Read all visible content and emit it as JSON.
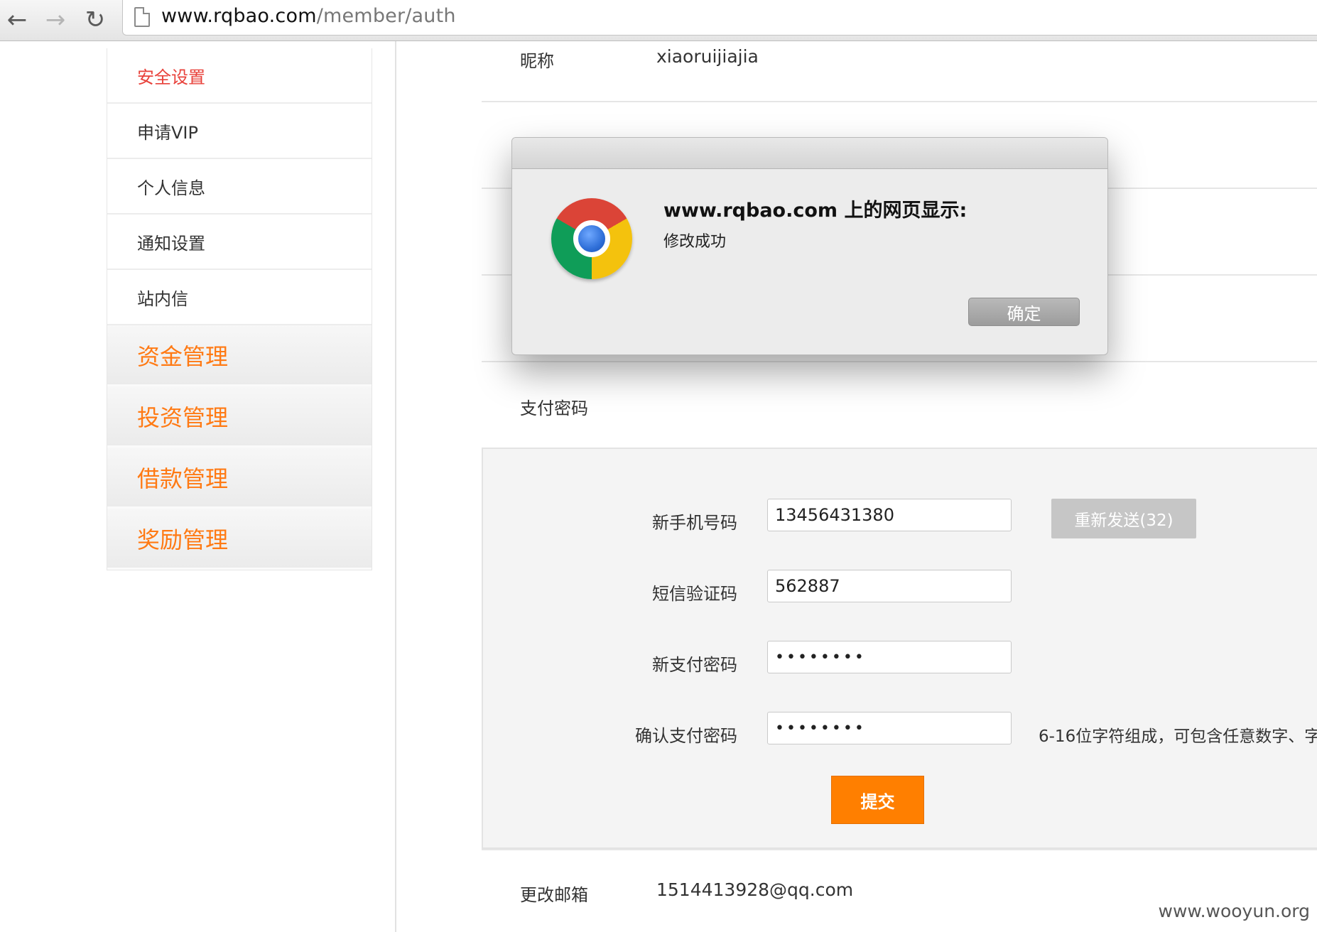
{
  "browser": {
    "url_host": "www.rqbao.com",
    "url_path": "/member/auth"
  },
  "sidebar": {
    "items": [
      {
        "label": "安全设置"
      },
      {
        "label": "申请VIP"
      },
      {
        "label": "个人信息"
      },
      {
        "label": "通知设置"
      },
      {
        "label": "站内信"
      }
    ],
    "groups": [
      {
        "label": "资金管理"
      },
      {
        "label": "投资管理"
      },
      {
        "label": "借款管理"
      },
      {
        "label": "奖励管理"
      }
    ]
  },
  "profile": {
    "nickname_label": "昵称",
    "nickname_value": "xiaoruijiajia",
    "pay_password_label": "支付密码",
    "email_label": "更改邮箱",
    "email_value": "1514413928@qq.com"
  },
  "form": {
    "phone_label": "新手机号码",
    "phone_value": "13456431380",
    "resend_label": "重新发送(32)",
    "sms_label": "短信验证码",
    "sms_value": "562887",
    "new_pw_label": "新支付密码",
    "new_pw_value": "••••••••",
    "confirm_pw_label": "确认支付密码",
    "confirm_pw_value": "••••••••",
    "hint": "6-16位字符组成，可包含任意数字、字",
    "submit_label": "提交"
  },
  "dialog": {
    "title": "www.rqbao.com 上的网页显示:",
    "message": "修改成功",
    "ok_label": "确定"
  },
  "watermark": "www.wooyun.org"
}
